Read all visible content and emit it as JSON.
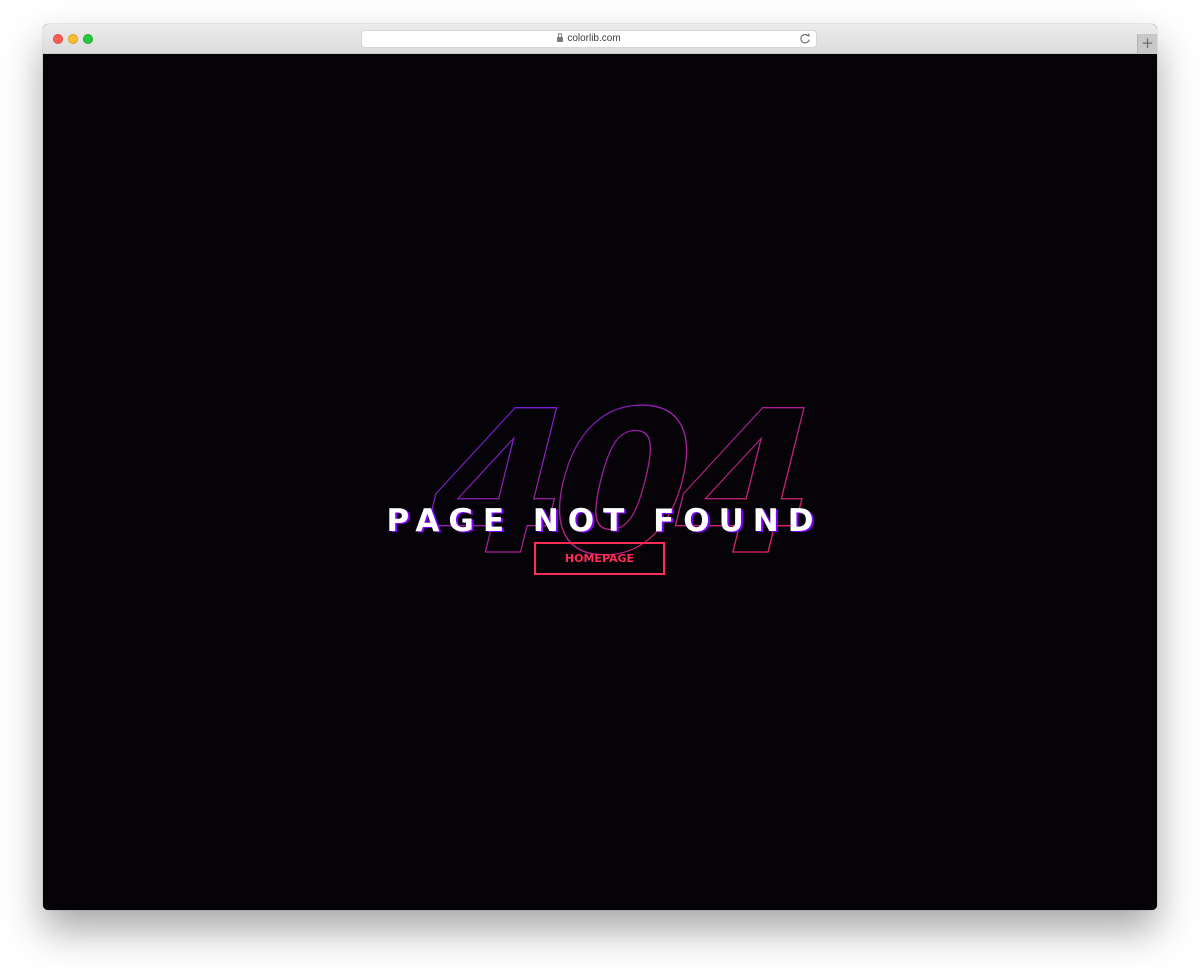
{
  "browser": {
    "url": "colorlib.com",
    "new_tab_label": "+"
  },
  "page": {
    "code": "404",
    "headline": "PAGE NOT FOUND",
    "button_label": "HOMEPAGE"
  },
  "colors": {
    "background": "#050308",
    "accent_pink": "#ff2c54",
    "accent_purple": "#8400ff"
  }
}
